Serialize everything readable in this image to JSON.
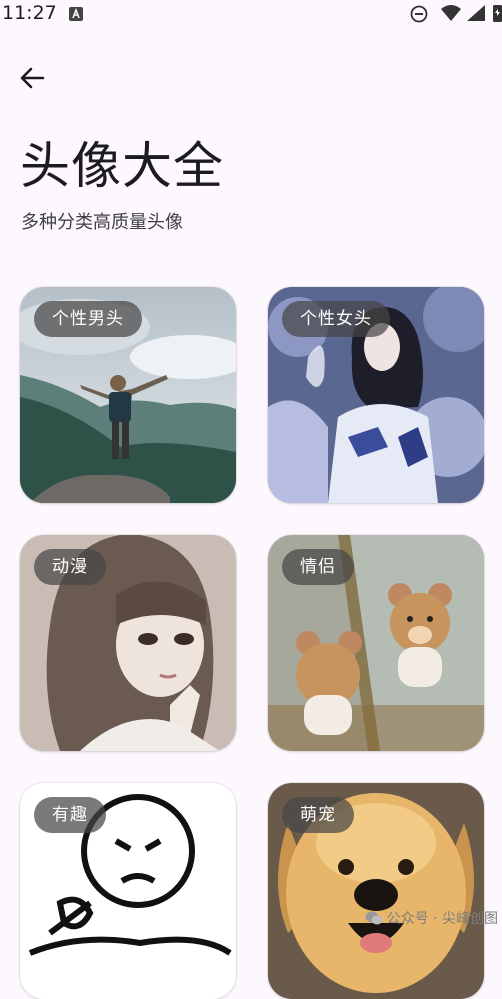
{
  "status_bar": {
    "time": "11:27"
  },
  "page": {
    "title": "头像大全",
    "subtitle": "多种分类高质量头像"
  },
  "categories": [
    {
      "label": "个性男头"
    },
    {
      "label": "个性女头"
    },
    {
      "label": "动漫"
    },
    {
      "label": "情侣"
    },
    {
      "label": "有趣"
    },
    {
      "label": "萌宠"
    }
  ],
  "watermark": {
    "text": "公众号 · 尖峰创图"
  },
  "colors": {
    "background": "#fdf8fd",
    "chip": "#464646",
    "text": "#1c1b1f"
  },
  "icons": [
    "back-arrow-icon",
    "dnd-icon",
    "wifi-icon",
    "signal-icon",
    "battery-icon",
    "notification-icon",
    "wechat-icon"
  ]
}
